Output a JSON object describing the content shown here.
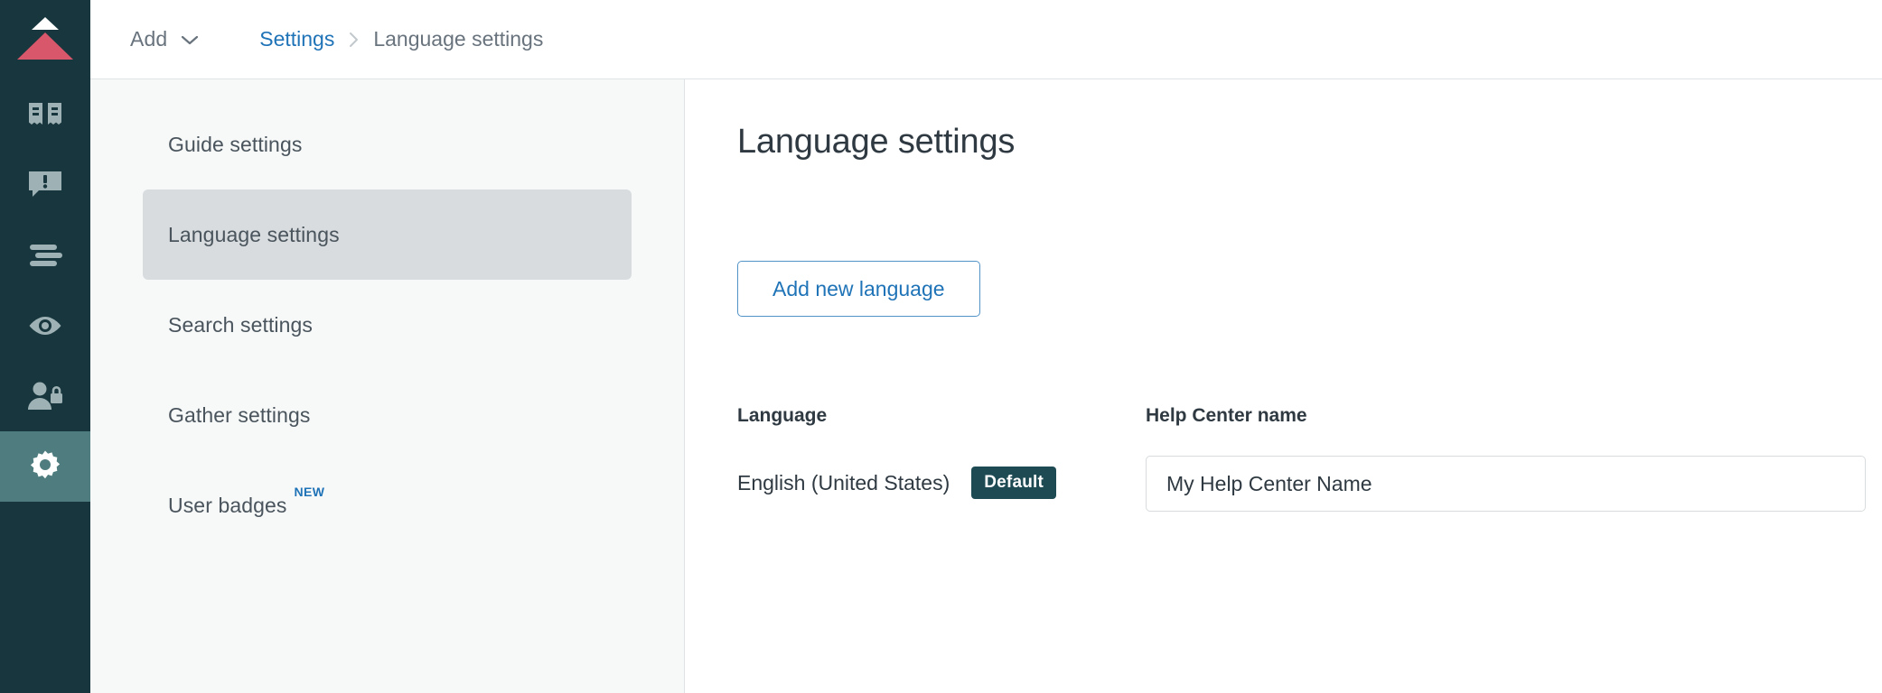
{
  "rail": {
    "logo": {
      "name": "zendesk-guide-logo",
      "top_color": "#ffffff",
      "bottom_color": "#d9576a"
    },
    "items": [
      {
        "icon": "knowledge-base-icon",
        "label": "Knowledge base",
        "active": false
      },
      {
        "icon": "alert-chat-icon",
        "label": "Alerts",
        "active": false
      },
      {
        "icon": "content-list-icon",
        "label": "Content",
        "active": false
      },
      {
        "icon": "eye-icon",
        "label": "Preview",
        "active": false
      },
      {
        "icon": "user-lock-icon",
        "label": "Permissions",
        "active": false
      },
      {
        "icon": "gear-icon",
        "label": "Settings",
        "active": true
      }
    ]
  },
  "header": {
    "add_label": "Add",
    "add_chevron_icon": "chevron-down-icon",
    "breadcrumb": {
      "parent": "Settings",
      "separator_icon": "chevron-right-icon",
      "current": "Language settings"
    }
  },
  "subnav": {
    "items": [
      {
        "label": "Guide settings",
        "selected": false,
        "badge": ""
      },
      {
        "label": "Language settings",
        "selected": true,
        "badge": ""
      },
      {
        "label": "Search settings",
        "selected": false,
        "badge": ""
      },
      {
        "label": "Gather settings",
        "selected": false,
        "badge": ""
      },
      {
        "label": "User badges",
        "selected": false,
        "badge": "NEW"
      }
    ]
  },
  "content": {
    "title": "Language settings",
    "add_language_button": "Add new language",
    "language_column_label": "Language",
    "language_value": "English (United States)",
    "default_badge": "Default",
    "help_center_name_label": "Help Center name",
    "help_center_name_value": "My Help Center Name",
    "help_center_name_placeholder": "My Help Center Name"
  },
  "colors": {
    "rail_bg": "#17363d",
    "rail_active_bg": "#4f7d7f",
    "accent_blue": "#1f73b7",
    "subnav_bg": "#f7f8f8",
    "subnav_selected_bg": "#d8dcde",
    "badge_bg": "#1e4a54",
    "text_primary": "#2f3941",
    "text_secondary": "#68737d",
    "logo_red": "#d9576a"
  }
}
